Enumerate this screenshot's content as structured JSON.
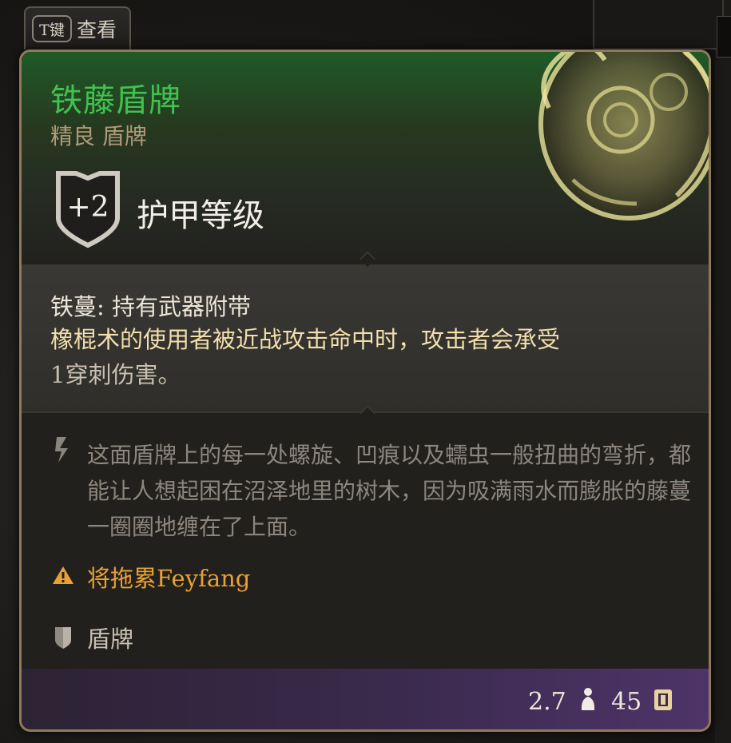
{
  "hint": {
    "key": "T键",
    "label": "查看"
  },
  "item": {
    "name": "铁藤盾牌",
    "rarity_type": "精良 盾牌",
    "armor_bonus": "+2",
    "armor_label": "护甲等级"
  },
  "property": {
    "name": "铁蔓: 持有武器附带",
    "description": "橡棍术的使用者被近战攻击命中时，攻击者会承受",
    "description_line2": "1穿刺伤害。"
  },
  "lore": "这面盾牌上的每一处螺旋、凹痕以及蠕虫一般扭曲的弯折，都能让人想起困在沼泽地里的树木，因为吸满雨水而膨胀的藤蔓一圈圈地缠在了上面。",
  "warning": "将拖累Feyfang",
  "item_type": "盾牌",
  "footer": {
    "weight": "2.7",
    "price": "45"
  },
  "colors": {
    "title_green": "#3fc24f",
    "warning_orange": "#e8a234",
    "property_gold": "#f2dfae",
    "border_bronze": "#8f7a5c",
    "footer_purple": "#4e3468"
  },
  "icons": [
    "shield-armor-icon",
    "vine-shield-artwork",
    "lore-quill-icon",
    "warning-icon",
    "shield-type-icon",
    "weight-icon",
    "gold-coin-icon"
  ]
}
